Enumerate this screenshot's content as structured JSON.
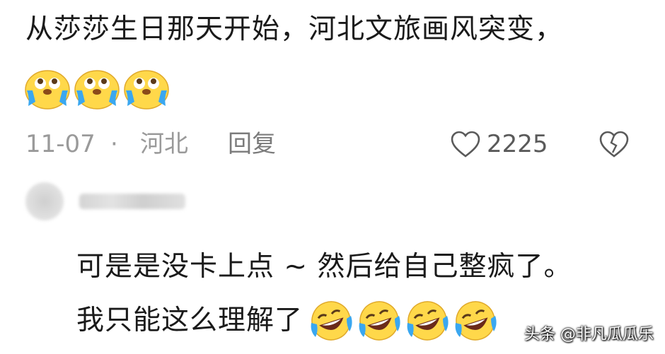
{
  "comment": {
    "text": "从莎莎生日那天开始，河北文旅画风突变，",
    "emoji_names": [
      "crying-face-icon",
      "crying-face-icon",
      "crying-face-icon"
    ],
    "date": "11-07",
    "separator": "·",
    "location": "河北",
    "reply_label": "回复",
    "like_count": "2225"
  },
  "reply": {
    "line1": "可是是没卡上点 ~ 然后给自己整疯了。",
    "line2": "我只能这么理解了",
    "emoji_names": [
      "laughing-face-icon",
      "laughing-face-icon",
      "laughing-face-icon",
      "laughing-face-icon"
    ]
  },
  "watermark": "头条 @非凡瓜瓜乐",
  "colors": {
    "text": "#1a1a1a",
    "meta": "#9a9a9a",
    "emoji_yellow": "#ffd84a",
    "tear_blue": "#3aa7f0"
  }
}
